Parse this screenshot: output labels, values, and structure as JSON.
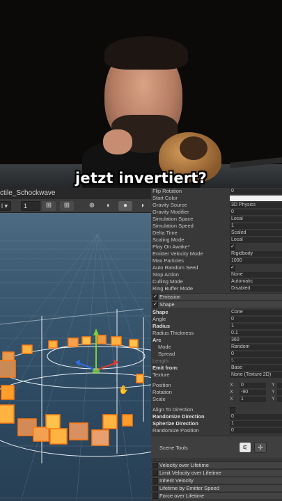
{
  "caption": "jetzt invertiert?",
  "scene": {
    "tab_title": "ctile_Schockwave",
    "toolbar": {
      "shading_mode": "l",
      "scale_value": "1"
    }
  },
  "inspector": {
    "props_top": [
      {
        "label": "Flip Rotation",
        "value": "0"
      },
      {
        "label": "Start Color",
        "value": ""
      },
      {
        "label": "Gravity Source",
        "value": "3D Physics"
      },
      {
        "label": "Gravity Modifier",
        "value": "0"
      },
      {
        "label": "Simulation Space",
        "value": "Local"
      },
      {
        "label": "Simulation Speed",
        "value": "1"
      },
      {
        "label": "Delta Time",
        "value": "Scaled"
      },
      {
        "label": "Scaling Mode",
        "value": "Local"
      },
      {
        "label": "Play On Awake*",
        "value": "✓"
      },
      {
        "label": "Emitter Velocity Mode",
        "value": "Rigidbody"
      },
      {
        "label": "Max Particles",
        "value": "1000"
      },
      {
        "label": "Auto Random Seed",
        "value": "✓"
      },
      {
        "label": "Stop Action",
        "value": "None"
      },
      {
        "label": "Culling Mode",
        "value": "Automatic"
      },
      {
        "label": "Ring Buffer Mode",
        "value": "Disabled"
      }
    ],
    "modules_top": [
      {
        "label": "Emission",
        "checked": "✓"
      },
      {
        "label": "Shape",
        "checked": "✓"
      }
    ],
    "shape_props": [
      {
        "label": "Shape",
        "value": "Cone"
      },
      {
        "label": "Angle",
        "value": "0"
      },
      {
        "label": "Radius",
        "value": "1"
      },
      {
        "label": "Radius Thickness",
        "value": "0.1"
      },
      {
        "label": "Arc",
        "value": "360"
      },
      {
        "label": "Mode",
        "value": "Random"
      },
      {
        "label": "Spread",
        "value": "0"
      },
      {
        "label": "Length",
        "value": "5"
      },
      {
        "label": "Emit from:",
        "value": "Base"
      },
      {
        "label": "Texture",
        "value": "None (Texture 2D)"
      }
    ],
    "transform": {
      "position_label": "Position",
      "rotation_label": "Rotation",
      "scale_label": "Scale",
      "x": "X",
      "y": "Y",
      "position_x": "0",
      "rotation_x": "-90",
      "scale_x": "1"
    },
    "shape_bottom": [
      {
        "label": "Align To Direction",
        "value": ""
      },
      {
        "label": "Randomize Direction",
        "value": "0"
      },
      {
        "label": "Spherize Direction",
        "value": "1"
      },
      {
        "label": "Randomize Position",
        "value": "0"
      }
    ],
    "scene_tools_label": "Scene Tools",
    "modules_bottom": [
      {
        "label": "Velocity over Lifetime"
      },
      {
        "label": "Limit Velocity over Lifetime"
      },
      {
        "label": "Inherit Velocity"
      },
      {
        "label": "Lifetime by Emitter Speed"
      },
      {
        "label": "Force over Lifetime"
      }
    ]
  }
}
